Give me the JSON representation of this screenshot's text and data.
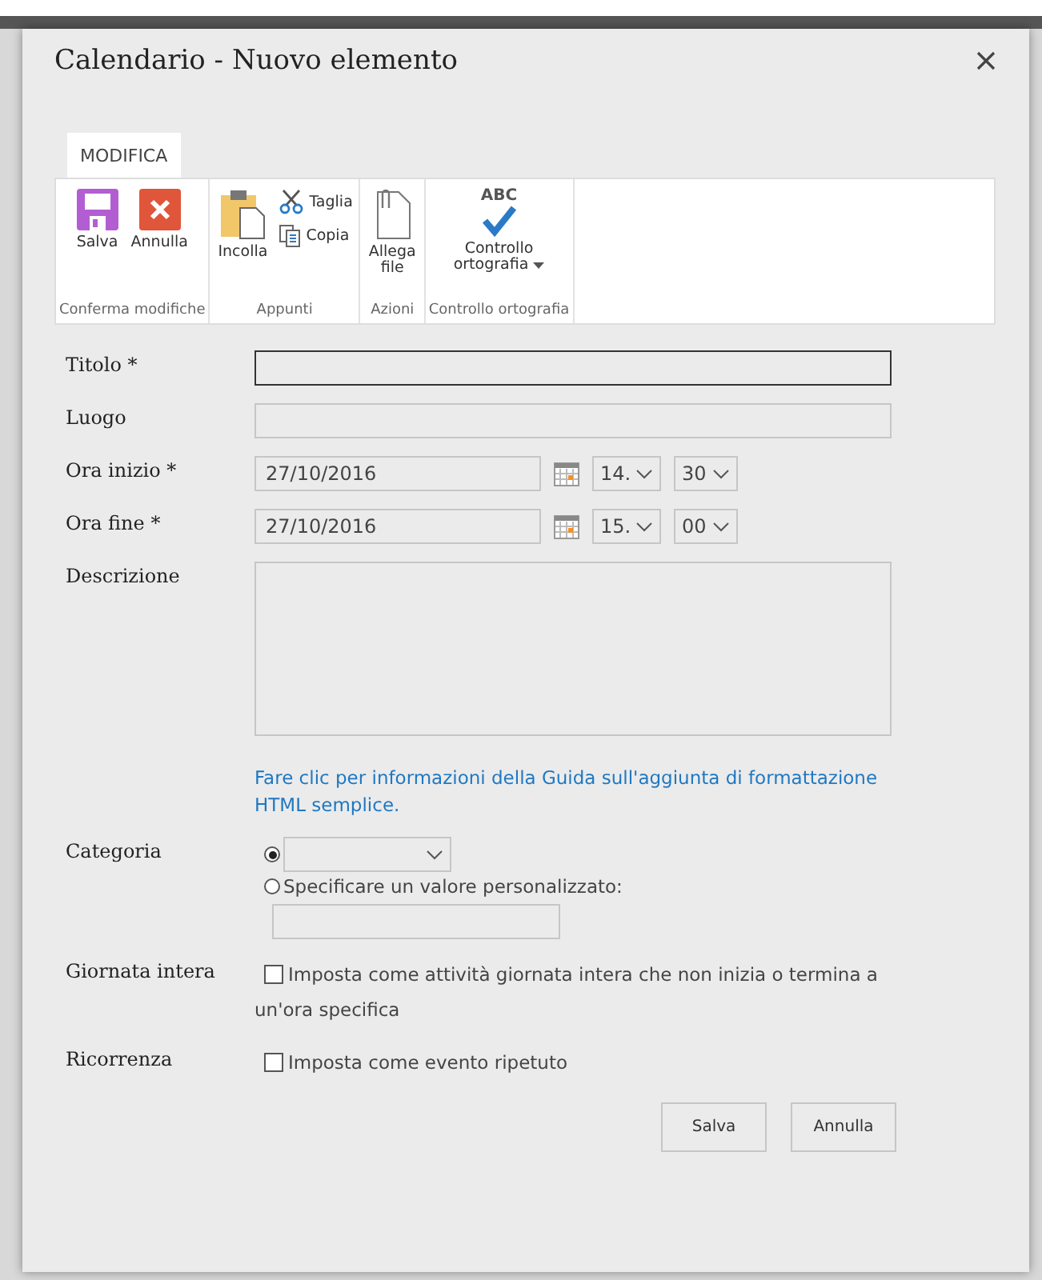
{
  "dialog": {
    "title": "Calendario - Nuovo elemento"
  },
  "ribbon": {
    "tabs": [
      {
        "label": "MODIFICA",
        "selected": true
      }
    ],
    "groups": [
      {
        "label": "Conferma modifiche",
        "buttons": [
          {
            "kind": "save",
            "label": "Salva"
          },
          {
            "kind": "cancel",
            "label": "Annulla"
          }
        ]
      },
      {
        "label": "Appunti",
        "buttons": [
          {
            "kind": "paste",
            "label": "Incolla"
          }
        ],
        "small_buttons": [
          {
            "kind": "cut",
            "label": "Taglia"
          },
          {
            "kind": "copy",
            "label": "Copia"
          }
        ]
      },
      {
        "label": "Azioni",
        "buttons": [
          {
            "kind": "attach",
            "label": "Allega\nfile"
          }
        ]
      },
      {
        "label": "Controllo ortografia",
        "buttons": [
          {
            "kind": "spelling",
            "label": "Controllo\nortografia",
            "dropdown": true,
            "icon_text": "ABC"
          }
        ]
      }
    ]
  },
  "form": {
    "rows": [
      {
        "kind": "text",
        "label": "Titolo *",
        "focused": true
      },
      {
        "kind": "text",
        "label": "Luogo",
        "focused": false
      },
      {
        "kind": "datetime",
        "label": "Ora inizio *",
        "date": "27/10/2016",
        "hour": "14.",
        "minute": "30"
      },
      {
        "kind": "datetime",
        "label": "Ora fine *",
        "date": "27/10/2016",
        "hour": "15.",
        "minute": "00"
      },
      {
        "kind": "textarea",
        "label": "Descrizione",
        "help_link": "Fare clic per informazioni della Guida sull'aggiunta di formattazione HTML semplice."
      },
      {
        "kind": "choice",
        "label": "Categoria",
        "options": [
          {
            "kind": "dropdown",
            "selected": true
          },
          {
            "kind": "custom",
            "label": "Specificare un valore personalizzato:",
            "selected": false
          }
        ]
      },
      {
        "kind": "checkbox",
        "label": "Giornata intera",
        "text": "Imposta come attività giornata intera che non inizia o termina a un'ora specifica",
        "checked": false
      },
      {
        "kind": "checkbox",
        "label": "Ricorrenza",
        "text": "Imposta come evento ripetuto",
        "checked": false
      }
    ]
  },
  "buttons": [
    "Salva",
    "Annulla"
  ]
}
